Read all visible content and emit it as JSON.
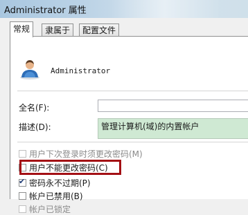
{
  "window": {
    "title": "Administrator 属性"
  },
  "tabs": [
    {
      "label": "常规",
      "active": true
    },
    {
      "label": "隶属于",
      "active": false
    },
    {
      "label": "配置文件",
      "active": false
    }
  ],
  "general": {
    "user_icon": "user-icon",
    "username": "Administrator",
    "full_name_label": "全名(F):",
    "full_name_value": "",
    "description_label": "描述(D):",
    "description_value": "管理计算机(域)的内置帐户"
  },
  "options": [
    {
      "label": "用户下次登录时须更改密码(M)",
      "checked": false,
      "disabled": true
    },
    {
      "label": "用户不能更改密码(C)",
      "checked": false,
      "disabled": false,
      "highlighted": true
    },
    {
      "label": "密码永不过期(P)",
      "checked": true,
      "disabled": false
    },
    {
      "label": "帐户已禁用(B)",
      "checked": false,
      "disabled": false
    },
    {
      "label": "帐户已锁定",
      "checked": false,
      "disabled": true
    }
  ],
  "colors": {
    "highlight_border": "#a30f14",
    "description_bg": "#cfe9d3",
    "titlebar": "#bcd3e6"
  }
}
